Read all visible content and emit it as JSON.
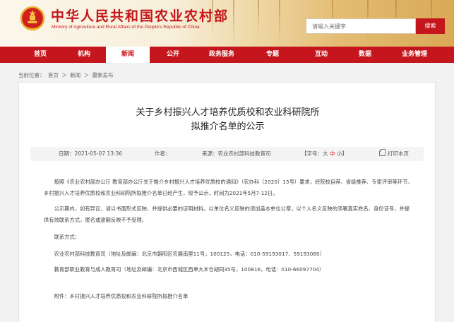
{
  "header": {
    "site_title": "中华人民共和国农业农村部",
    "site_subtitle": "Ministry of Agriculture and Rural Affairs of the People's Republic of China",
    "search_placeholder": "请输入关键字",
    "search_button": "搜索",
    "colors": {
      "brand_red": "#c4161c"
    }
  },
  "nav": {
    "items": [
      {
        "label": "首页"
      },
      {
        "label": "机构"
      },
      {
        "label": "新闻"
      },
      {
        "label": "公开"
      },
      {
        "label": "政务服务"
      },
      {
        "label": "专题"
      },
      {
        "label": "互动"
      },
      {
        "label": "数据"
      },
      {
        "label": "业务管理"
      }
    ],
    "active_index": 2
  },
  "breadcrumb": {
    "prefix": "当前位置：",
    "items": [
      "首页",
      "新闻",
      "最新发布"
    ],
    "separator": "＞"
  },
  "article": {
    "title_line1": "关于乡村振兴人才培养优质校和农业科研院所",
    "title_line2": "拟推介名单的公示",
    "meta": {
      "date": "日期：2021-05-07 13:36",
      "author": "作者：",
      "source": "来源：农业农村部科技教育司",
      "font_prefix": "【字号：",
      "font_large": "大",
      "font_medium": "中",
      "font_small": "小",
      "font_suffix": "】",
      "print_label": "打印本页"
    },
    "paragraphs": {
      "p1": "按照《农业农村部办公厅 教育部办公厅关于推介乡村振兴人才培养优质校的通知》（农办科〔2020〕15号）要求，经院校自荐、省级推荐、专家评审等环节，乡村振兴人才培养优质校和农业科研院所拟推介名单已经产生，现予公示，时间为2021年5月7-12日。",
      "p2": "公示期内，如有异议，请以书面形式反映，并提供必要的证明材料。以单位名义反映的须加盖本单位公章，以个人名义反映的须署真实姓名、身份证号，并提供有效联系方式，匿名或逾期反映不予受理。",
      "contact_label": "联系方式：",
      "contact1": "农业农村部科技教育司（地址及邮编：北京市朝阳区农展南里11号，100125，电话：010-59193017、59193080）",
      "contact2": "教育部职业教育与成人教育司（地址及邮编：北京市西城区西单大木仓胡同35号，100816，电话：010-66097704）",
      "attachment": "附件：乡村振兴人才培养优质校和农业科研院所拟推介名单"
    }
  }
}
